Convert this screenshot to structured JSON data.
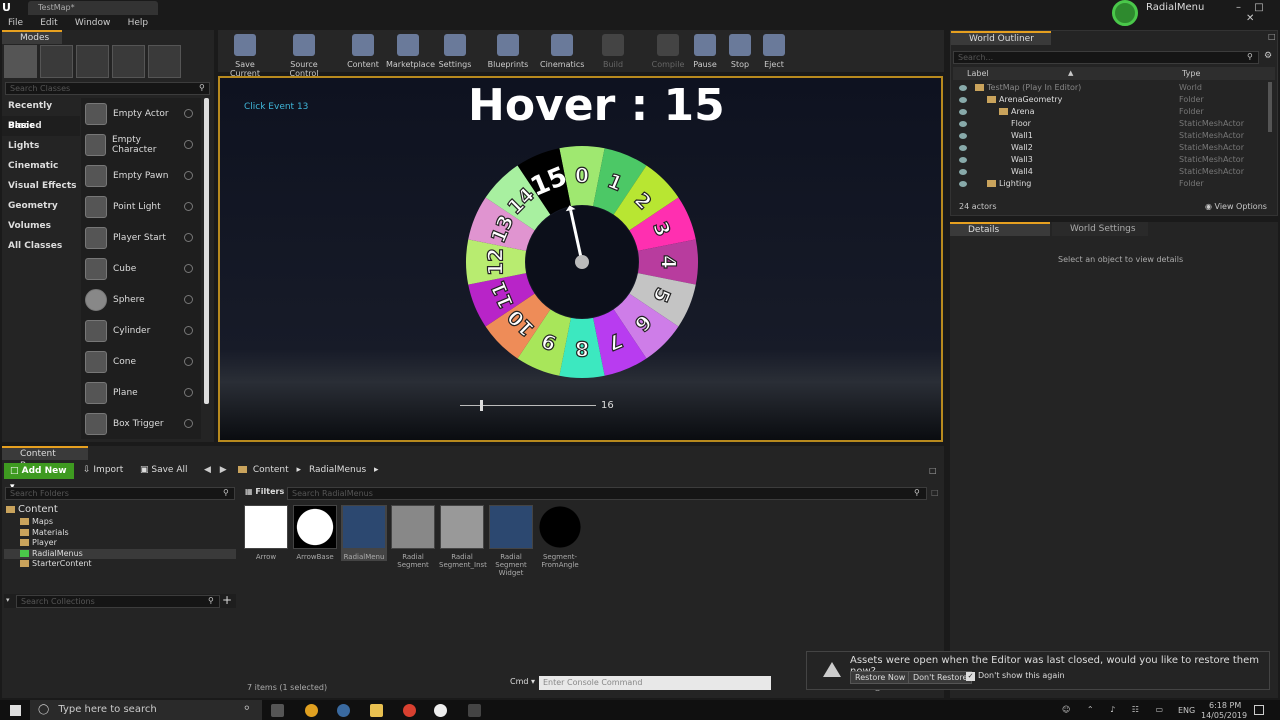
{
  "app": {
    "tab_title": "TestMap*",
    "project_name": "RadialMenu",
    "menu": [
      "File",
      "Edit",
      "Window",
      "Help"
    ]
  },
  "modes": {
    "title": "Modes",
    "search_placeholder": "Search Classes",
    "categories": [
      "Recently Placed",
      "Basic",
      "Lights",
      "Cinematic",
      "Visual Effects",
      "Geometry",
      "Volumes",
      "All Classes"
    ],
    "selected_category": "Basic",
    "items": [
      "Empty Actor",
      "Empty Character",
      "Empty Pawn",
      "Point Light",
      "Player Start",
      "Cube",
      "Sphere",
      "Cylinder",
      "Cone",
      "Plane",
      "Box Trigger"
    ]
  },
  "toolbar": {
    "buttons": [
      {
        "label": "Save Current",
        "icon": "save-icon",
        "enabled": true
      },
      {
        "label": "Source Control",
        "icon": "source-control-icon",
        "enabled": true
      },
      {
        "label": "Content",
        "icon": "content-icon",
        "enabled": true
      },
      {
        "label": "Marketplace",
        "icon": "marketplace-icon",
        "enabled": true
      },
      {
        "label": "Settings",
        "icon": "settings-icon",
        "enabled": true
      },
      {
        "label": "Blueprints",
        "icon": "blueprints-icon",
        "enabled": true
      },
      {
        "label": "Cinematics",
        "icon": "cinematics-icon",
        "enabled": true
      },
      {
        "label": "Build",
        "icon": "build-icon",
        "enabled": false
      },
      {
        "label": "Compile",
        "icon": "compile-icon",
        "enabled": false
      },
      {
        "label": "Pause",
        "icon": "pause-icon",
        "enabled": true
      },
      {
        "label": "Stop",
        "icon": "stop-icon",
        "enabled": true
      },
      {
        "label": "Eject",
        "icon": "eject-icon",
        "enabled": true
      }
    ]
  },
  "viewport": {
    "click_event": "Click Event 13",
    "hover_text": "Hover : 15",
    "slider_value": "16",
    "slider_fraction": 0.15,
    "wheel_segments": [
      {
        "label": "0",
        "color": "#9fe870"
      },
      {
        "label": "1",
        "color": "#4cc866"
      },
      {
        "label": "2",
        "color": "#b8e632"
      },
      {
        "label": "3",
        "color": "#ff2fb0"
      },
      {
        "label": "4",
        "color": "#b83c9e"
      },
      {
        "label": "5",
        "color": "#c4c4c4"
      },
      {
        "label": "6",
        "color": "#ce7de8"
      },
      {
        "label": "7",
        "color": "#b83cf0"
      },
      {
        "label": "8",
        "color": "#3ce8c0"
      },
      {
        "label": "9",
        "color": "#a8e65a"
      },
      {
        "label": "10",
        "color": "#ee8c58"
      },
      {
        "label": "11",
        "color": "#b824c8"
      },
      {
        "label": "12",
        "color": "#b8ec70"
      },
      {
        "label": "13",
        "color": "#e094d0"
      },
      {
        "label": "14",
        "color": "#a8f0a0"
      },
      {
        "label": "15",
        "color": "#000000"
      }
    ]
  },
  "outliner": {
    "title": "World Outliner",
    "search_placeholder": "Search...",
    "col_label": "Label",
    "col_type": "Type",
    "rows": [
      {
        "label": "TestMap (Play In Editor)",
        "type": "World",
        "indent": 0
      },
      {
        "label": "ArenaGeometry",
        "type": "Folder",
        "indent": 1
      },
      {
        "label": "Arena",
        "type": "Folder",
        "indent": 2
      },
      {
        "label": "Floor",
        "type": "StaticMeshActor",
        "indent": 3
      },
      {
        "label": "Wall1",
        "type": "StaticMeshActor",
        "indent": 3
      },
      {
        "label": "Wall2",
        "type": "StaticMeshActor",
        "indent": 3
      },
      {
        "label": "Wall3",
        "type": "StaticMeshActor",
        "indent": 3
      },
      {
        "label": "Wall4",
        "type": "StaticMeshActor",
        "indent": 3
      },
      {
        "label": "Lighting",
        "type": "Folder",
        "indent": 1
      }
    ],
    "actor_count": "24 actors",
    "view_options": "View Options"
  },
  "details": {
    "tab1": "Details",
    "tab2": "World Settings",
    "empty_text": "Select an object to view details"
  },
  "content_browser": {
    "title": "Content Browser",
    "add_new": "Add New",
    "import": "Import",
    "save_all": "Save All",
    "path": [
      "Content",
      "RadialMenus"
    ],
    "search_folders": "Search Folders",
    "filters": "Filters",
    "search_assets": "Search RadialMenus",
    "tree": [
      {
        "label": "Content",
        "indent": 0
      },
      {
        "label": "Maps",
        "indent": 1
      },
      {
        "label": "Materials",
        "indent": 1
      },
      {
        "label": "Player",
        "indent": 1
      },
      {
        "label": "RadialMenus",
        "indent": 1
      },
      {
        "label": "StarterContent",
        "indent": 1
      }
    ],
    "selected_folder": "RadialMenus",
    "search_collections": "Search Collections",
    "assets": [
      "Arrow",
      "ArrowBase",
      "RadialMenu",
      "Radial Segment",
      "Radial Segment_Inst",
      "Radial Segment Widget",
      "Segment-FromAngle"
    ],
    "selected_asset": "RadialMenu",
    "items_count": "7 items (1 selected)"
  },
  "console": {
    "cmd_label": "Cmd",
    "placeholder": "Enter Console Command"
  },
  "notification": {
    "message": "Assets were open when the Editor was last closed, would you like to restore them now?",
    "restore": "Restore Now",
    "dont_restore": "Don't Restore",
    "dont_show": "Don't show this again"
  },
  "taskbar": {
    "search_placeholder": "Type here to search",
    "lang": "ENG",
    "time": "6:18 PM",
    "date": "14/05/2019"
  }
}
